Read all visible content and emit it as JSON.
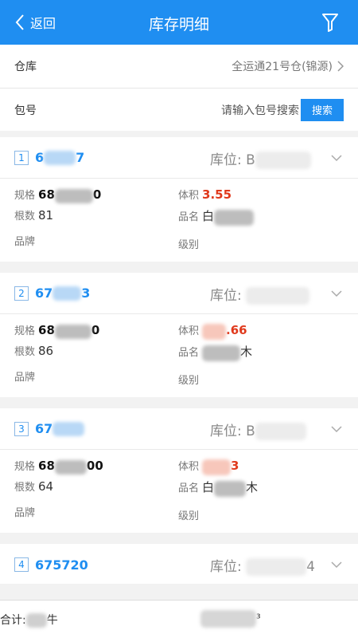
{
  "header": {
    "back_label": "返回",
    "title": "库存明细"
  },
  "filters": {
    "warehouse_label": "仓库",
    "warehouse_value": "全运通21号仓(锦源)",
    "package_label": "包号",
    "package_placeholder": "请输入包号搜索",
    "search_button": "搜索"
  },
  "field_labels": {
    "spec": "规格",
    "volume": "体积",
    "count": "根数",
    "name": "品名",
    "brand": "品牌",
    "grade": "级别",
    "location": "库位:"
  },
  "items": [
    {
      "index": "1",
      "code_a": "6",
      "code_b": "7",
      "loc": "B",
      "spec_a": "68",
      "spec_b": "0",
      "volume": "3.55",
      "count": "81",
      "name_a": "白",
      "name_b": ""
    },
    {
      "index": "2",
      "code_a": "67",
      "code_b": "3",
      "loc": "",
      "spec_a": "68",
      "spec_b": "0",
      "volume": ".66",
      "count": "86",
      "name_a": "",
      "name_b": "木"
    },
    {
      "index": "3",
      "code_a": "67",
      "code_b": "",
      "loc": "B",
      "spec_a": "68",
      "spec_b": "00",
      "volume": "3",
      "count": "64",
      "name_a": "白",
      "name_b": "木"
    },
    {
      "index": "4",
      "code_a": "675720",
      "code_b": "",
      "loc": "",
      "loc_tail": "4"
    }
  ],
  "footer": {
    "total_label": "合计:",
    "total_tail": "牛",
    "tail2": "³"
  }
}
